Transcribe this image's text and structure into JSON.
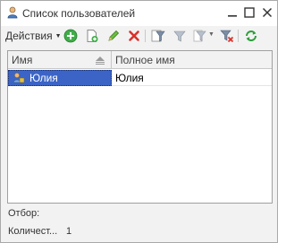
{
  "window": {
    "title": "Список пользователей",
    "icon": "user-icon",
    "controls": [
      "minimize-icon",
      "maximize-icon",
      "close-icon"
    ]
  },
  "toolbar": {
    "actions_label": "Действия",
    "icons": [
      "add-icon",
      "copy-icon",
      "edit-icon",
      "delete-icon",
      "filter-icon",
      "filter-by-value-icon",
      "filter-history-icon",
      "clear-filter-icon",
      "refresh-icon"
    ]
  },
  "table": {
    "columns": [
      "Имя",
      "Полное имя"
    ],
    "rows": [
      {
        "name": "Юлия",
        "full_name": "Юлия",
        "selected": true
      }
    ]
  },
  "footer": {
    "filter_label": "Отбор:",
    "count_label": "Количест...",
    "count_value": "1"
  },
  "colors": {
    "selection": "#3b64c6",
    "add": "#3fae49",
    "delete": "#d9312b",
    "refresh": "#2e9e3a"
  }
}
